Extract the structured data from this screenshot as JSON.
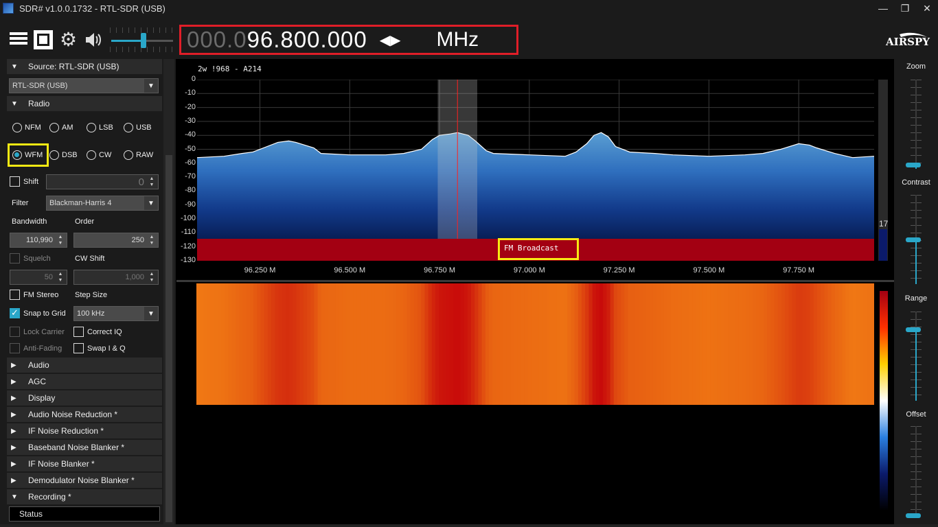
{
  "window": {
    "title": "SDR# v1.0.0.1732 - RTL-SDR (USB)",
    "buttons": [
      "—",
      "❐",
      "✕"
    ]
  },
  "toolbar": {
    "volume_level": 0.52,
    "frequency_dim": "000.0",
    "frequency_main": "96.800.000",
    "frequency_unit": "MHz",
    "brand": "AIRSPY"
  },
  "left_panel": {
    "source_header": "Source: RTL-SDR (USB)",
    "source_value": "RTL-SDR (USB)",
    "radio_header": "Radio",
    "modes": [
      "NFM",
      "AM",
      "LSB",
      "USB",
      "WFM",
      "DSB",
      "CW",
      "RAW"
    ],
    "selected_mode": "WFM",
    "shift_label": "Shift",
    "shift_value": "0",
    "filter_label": "Filter",
    "filter_value": "Blackman-Harris 4",
    "bandwidth_label": "Bandwidth",
    "order_label": "Order",
    "bandwidth_value": "110,990",
    "order_value": "250",
    "squelch_label": "Squelch",
    "cw_shift_label": "CW Shift",
    "squelch_value": "50",
    "cw_shift_value": "1,000",
    "fm_stereo_label": "FM Stereo",
    "step_size_label": "Step Size",
    "snap_label": "Snap to Grid",
    "step_value": "100 kHz",
    "lock_carrier_label": "Lock Carrier",
    "correct_iq_label": "Correct IQ",
    "anti_fading_label": "Anti-Fading",
    "swap_iq_label": "Swap I & Q",
    "collapsed_sections": [
      "Audio",
      "AGC",
      "Display",
      "Audio Noise Reduction *",
      "IF Noise Reduction *",
      "Baseband Noise Blanker *",
      "IF Noise Blanker *",
      "Demodulator Noise Blanker *"
    ],
    "recording_header": "Recording *",
    "status_label": "Status"
  },
  "spectrum": {
    "info": "2w !968  - A214",
    "band_label": "FM Broadcast",
    "right_scale_value": "17"
  },
  "chart_data": {
    "type": "area",
    "title": "",
    "xlabel": "",
    "ylabel": "",
    "ylim": [
      -130,
      0
    ],
    "xlim": [
      96.075,
      97.96
    ],
    "y_ticks": [
      "0",
      "-10",
      "-20",
      "-30",
      "-40",
      "-50",
      "-60",
      "-70",
      "-80",
      "-90",
      "-100",
      "-110",
      "-120",
      "-130"
    ],
    "x_ticks": [
      "96.250 M",
      "96.500 M",
      "96.750 M",
      "97.000 M",
      "97.250 M",
      "97.500 M",
      "97.750 M"
    ],
    "x_tick_values": [
      96.25,
      96.5,
      96.75,
      97.0,
      97.25,
      97.5,
      97.75
    ],
    "tuned_frequency": 96.8,
    "filter_band": [
      96.745,
      96.855
    ],
    "series": [
      {
        "x": [
          96.075,
          96.15,
          96.2,
          96.23,
          96.27,
          96.3,
          96.33,
          96.35,
          96.4,
          96.42,
          96.5,
          96.55,
          96.6,
          96.65,
          96.7,
          96.73,
          96.75,
          96.78,
          96.8,
          96.83,
          96.85,
          96.88,
          96.9,
          97.0,
          97.1,
          97.13,
          97.16,
          97.18,
          97.2,
          97.22,
          97.24,
          97.28,
          97.35,
          97.4,
          97.5,
          97.6,
          97.65,
          97.7,
          97.75,
          97.78,
          97.8,
          97.85,
          97.9,
          97.96
        ],
        "y": [
          -56,
          -55,
          -53,
          -52,
          -48,
          -45,
          -44,
          -45,
          -49,
          -53,
          -54,
          -54,
          -54,
          -53,
          -50,
          -43,
          -40,
          -39,
          -38,
          -40,
          -44,
          -51,
          -53,
          -54,
          -55,
          -52,
          -46,
          -40,
          -38,
          -41,
          -48,
          -52,
          -53,
          -54,
          -55,
          -54,
          -53,
          -50,
          -46,
          -47,
          -49,
          -53,
          -56,
          -55
        ]
      }
    ]
  },
  "right_panel": {
    "zoom_label": "Zoom",
    "contrast_label": "Contrast",
    "range_label": "Range",
    "offset_label": "Offset",
    "zoom_level": 0.05,
    "contrast_level": 0.5,
    "range_level": 0.8,
    "offset_level": 0.0
  },
  "colors": {
    "accent": "#2aa7c9",
    "highlight_red": "#e01e28",
    "highlight_yellow": "#f7ea13",
    "band_red": "#a30012"
  }
}
